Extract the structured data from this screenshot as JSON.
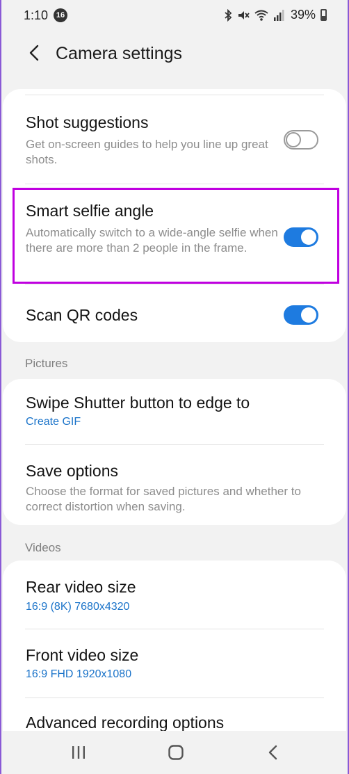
{
  "status_bar": {
    "time": "1:10",
    "notification_count": "16",
    "battery_percent": "39%"
  },
  "header": {
    "title": "Camera settings"
  },
  "card1": {
    "shot_suggestions": {
      "title": "Shot suggestions",
      "description": "Get on-screen guides to help you line up great shots.",
      "enabled": false
    },
    "smart_selfie_angle": {
      "title": "Smart selfie angle",
      "description": "Automatically switch to a wide-angle selfie when there are more than 2 people in the frame.",
      "enabled": true
    },
    "scan_qr": {
      "title": "Scan QR codes",
      "enabled": true
    }
  },
  "pictures": {
    "header": "Pictures",
    "swipe_shutter": {
      "title": "Swipe Shutter button to edge to",
      "value": "Create GIF"
    },
    "save_options": {
      "title": "Save options",
      "description": "Choose the format for saved pictures and whether to correct distortion when saving."
    }
  },
  "videos": {
    "header": "Videos",
    "rear_video_size": {
      "title": "Rear video size",
      "value": "16:9 (8K) 7680x4320"
    },
    "front_video_size": {
      "title": "Front video size",
      "value": "16:9 FHD 1920x1080"
    },
    "advanced_recording": {
      "title": "Advanced recording options"
    }
  },
  "colors": {
    "accent": "#1e7be0",
    "highlight": "#c000e0",
    "link": "#1a73c9"
  }
}
